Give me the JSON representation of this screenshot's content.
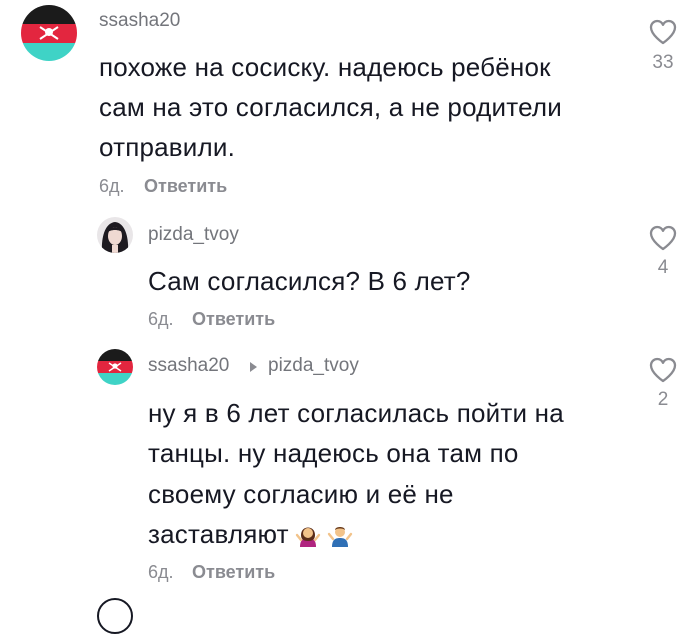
{
  "comments": [
    {
      "username": "ssasha20",
      "lines": [
        "похоже на сосиску. надеюсь ребёнок",
        "сам на это согласился, а не родители",
        "отправили."
      ],
      "date": "6д.",
      "reply_label": "Ответить",
      "likes": "33"
    },
    {
      "username": "pizda_tvoy",
      "lines": [
        "Сам согласился? В 6 лет?"
      ],
      "date": "6д.",
      "reply_label": "Ответить",
      "likes": "4"
    },
    {
      "username": "ssasha20",
      "reply_to": "pizda_tvoy",
      "lines": [
        "ну я в 6 лет согласилась пойти на",
        "танцы. ну надеюсь она там по",
        "своему согласию и её не",
        "заставляют"
      ],
      "emojis": [
        "woman-shrugging",
        "man-shrugging"
      ],
      "date": "6д.",
      "reply_label": "Ответить",
      "likes": "2"
    }
  ],
  "colors": {
    "text": "#161823",
    "muted": "#8a8b91",
    "avatar_pirate_red": "#e3263f",
    "avatar_pirate_black": "#1b1b1b",
    "avatar_pirate_teal": "#3fd3c6"
  }
}
